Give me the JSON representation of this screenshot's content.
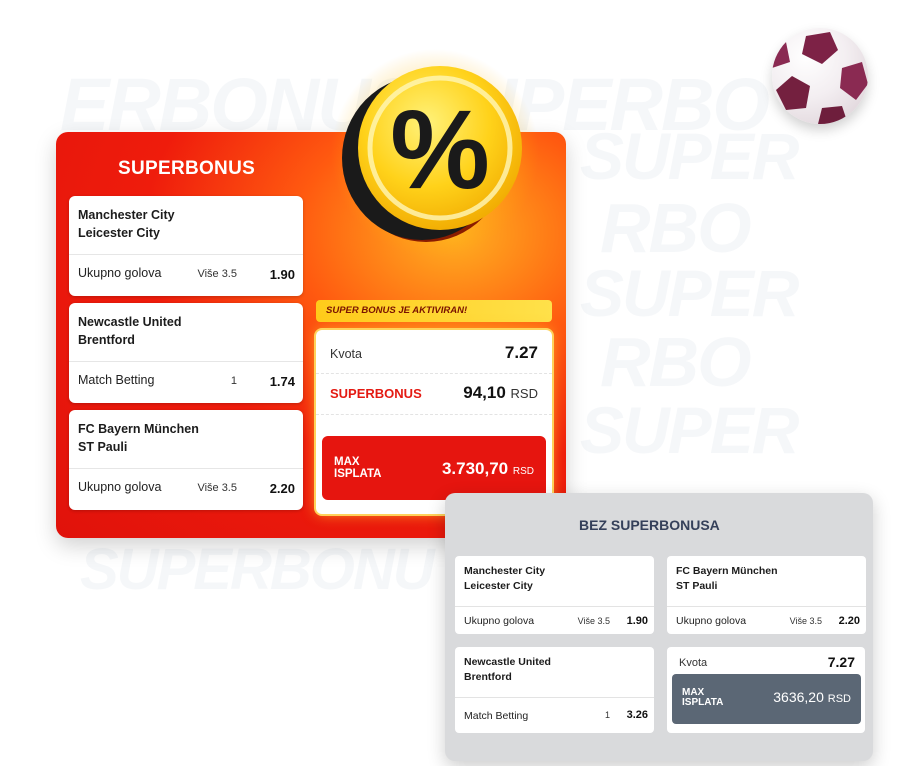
{
  "watermark": [
    "ERBONUSSUPERBO",
    "SUPER",
    "RBO",
    "SUPER",
    "RBO",
    "SUPER",
    "RBO",
    "SUPER",
    "SUPERBONU"
  ],
  "superbonus_card": {
    "title": "SUPERBONUS",
    "matches": [
      {
        "team1": "Manchester City",
        "team2": "Leicester City",
        "market": "Ukupno golova",
        "pick": "Više 3.5",
        "odd": "1.90"
      },
      {
        "team1": "Newcastle United",
        "team2": "Brentford",
        "market": "Match Betting",
        "pick": "1",
        "odd": "1.74"
      },
      {
        "team1": "FC Bayern München",
        "team2": "ST Pauli",
        "market": "Ukupno golova",
        "pick": "Više 3.5",
        "odd": "2.20"
      }
    ],
    "coin_symbol": "%",
    "activated_label": "SUPER BONUS JE AKTIVIRAN!",
    "kvota_label": "Kvota",
    "kvota_value": "7.27",
    "bonus_label": "SUPERBONUS",
    "bonus_value": "94,10",
    "bonus_currency": "RSD",
    "max_label_1": "MAX",
    "max_label_2": "ISPLATA",
    "max_value": "3.730,70",
    "max_currency": "RSD"
  },
  "no_bonus_card": {
    "title": "BEZ SUPERBONUSA",
    "matches": [
      {
        "team1": "Manchester City",
        "team2": "Leicester City",
        "market": "Ukupno golova",
        "pick": "Više 3.5",
        "odd": "1.90"
      },
      {
        "team1": "FC Bayern München",
        "team2": "ST Pauli",
        "market": "Ukupno golova",
        "pick": "Više 3.5",
        "odd": "2.20"
      },
      {
        "team1": "Newcastle United",
        "team2": "Brentford",
        "market": "Match Betting",
        "pick": "1",
        "odd": "3.26"
      }
    ],
    "kvota_label": "Kvota",
    "kvota_value": "7.27",
    "max_label_1": "MAX",
    "max_label_2": "ISPLATA",
    "max_value": "3636,20",
    "max_currency": "RSD"
  },
  "colors": {
    "red": "#e6150f",
    "yellow": "#ffd21a",
    "navy": "#35405a",
    "slate": "#5b6775",
    "grey_bg": "#d9dadc",
    "ball_maroon": "#7d2246"
  },
  "icons": {
    "ball": "soccer-ball-icon",
    "coin": "percent-coin-icon"
  }
}
